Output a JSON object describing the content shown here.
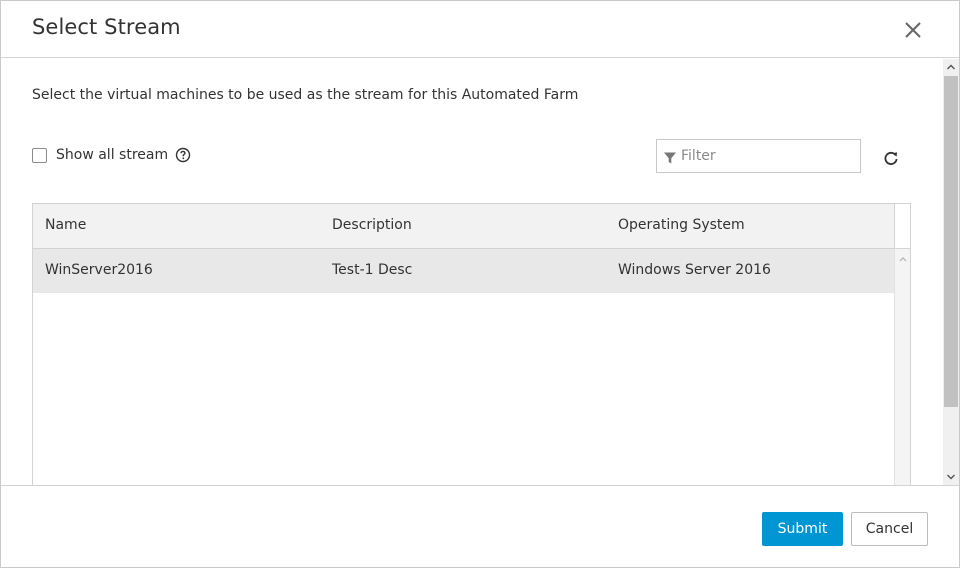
{
  "dialog": {
    "title": "Select Stream",
    "description": "Select the virtual machines to be used as the stream for this Automated Farm"
  },
  "toolbar": {
    "show_all_label": "Show all stream",
    "show_all_checked": false,
    "filter_placeholder": "Filter",
    "filter_value": ""
  },
  "table": {
    "columns": [
      "Name",
      "Description",
      "Operating System"
    ],
    "rows": [
      [
        "WinServer2016",
        "Test-1 Desc",
        "Windows Server 2016"
      ]
    ]
  },
  "footer": {
    "submit_label": "Submit",
    "cancel_label": "Cancel"
  },
  "colors": {
    "accent": "#0095d3",
    "selected_row": "#e8e8e8",
    "header_bg": "#f2f2f2"
  }
}
